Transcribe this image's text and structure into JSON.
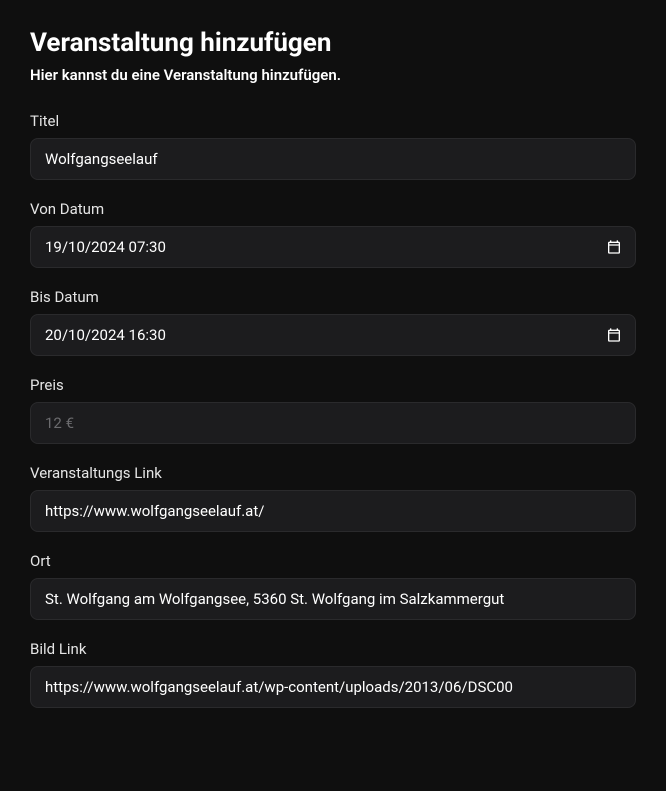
{
  "header": {
    "title": "Veranstaltung hinzufügen",
    "subtitle": "Hier kannst du eine Veranstaltung hinzufügen."
  },
  "form": {
    "titel": {
      "label": "Titel",
      "value": "Wolfgangseelauf"
    },
    "von_datum": {
      "label": "Von Datum",
      "value": "19/10/2024 07:30"
    },
    "bis_datum": {
      "label": "Bis Datum",
      "value": "20/10/2024 16:30"
    },
    "preis": {
      "label": "Preis",
      "placeholder": "12 €",
      "value": ""
    },
    "veranstaltungs_link": {
      "label": "Veranstaltungs Link",
      "value": "https://www.wolfgangseelauf.at/"
    },
    "ort": {
      "label": "Ort",
      "value": "St. Wolfgang am Wolfgangsee, 5360 St. Wolfgang im Salzkammergut"
    },
    "bild_link": {
      "label": "Bild Link",
      "value": "https://www.wolfgangseelauf.at/wp-content/uploads/2013/06/DSC00"
    }
  }
}
